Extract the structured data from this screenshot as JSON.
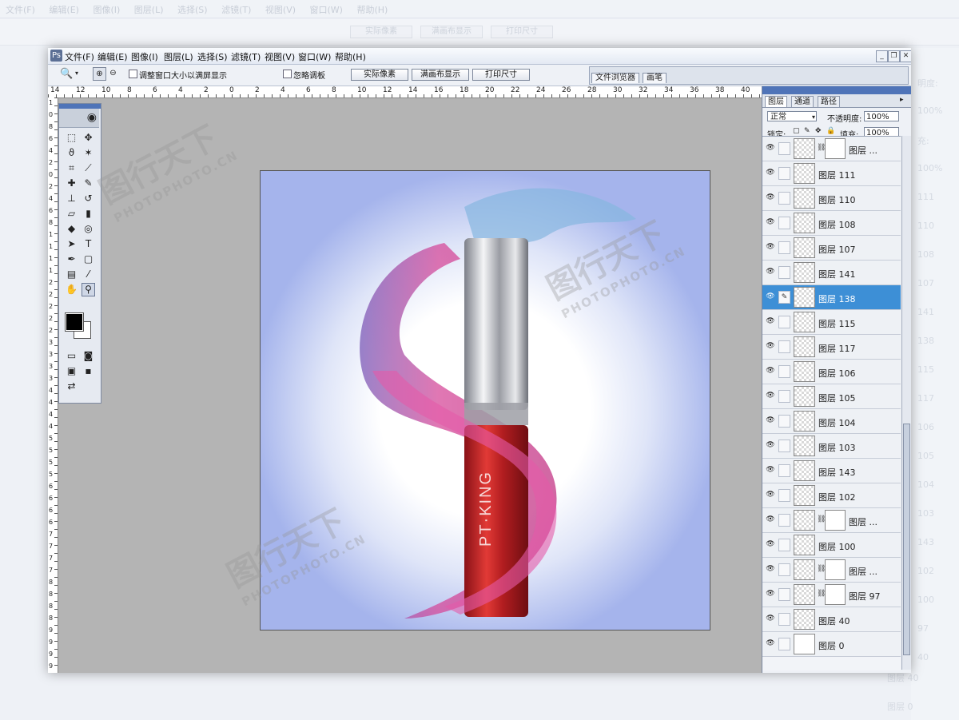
{
  "menu": [
    "文件(F)",
    "编辑(E)",
    "图像(I)",
    "图层(L)",
    "选择(S)",
    "滤镜(T)",
    "视图(V)",
    "窗口(W)",
    "帮助(H)"
  ],
  "options": {
    "fit_window_label": "调整窗口大小以满屏显示",
    "ignore_palettes_label": "忽略调板",
    "actual_pixels": "实际像素",
    "fit_on_screen": "满画布显示",
    "print_size": "打印尺寸"
  },
  "well_tabs": [
    "文件浏览器",
    "画笔"
  ],
  "ruler_h": [
    "14",
    "12",
    "10",
    "8",
    "6",
    "4",
    "2",
    "0",
    "2",
    "4",
    "6",
    "8",
    "10",
    "12",
    "14",
    "16",
    "18",
    "20",
    "22",
    "24",
    "26",
    "28",
    "30",
    "32",
    "34",
    "36",
    "38",
    "40"
  ],
  "ruler_v": [
    "1",
    "0",
    "8",
    "6",
    "4",
    "2",
    "0",
    "2",
    "4",
    "6",
    "8",
    "1",
    "1",
    "1",
    "1",
    "2",
    "2",
    "2",
    "2",
    "2",
    "3",
    "3",
    "3",
    "3",
    "4",
    "4",
    "4",
    "4",
    "5",
    "5",
    "5",
    "5",
    "6",
    "6",
    "6",
    "6",
    "7",
    "7",
    "7",
    "7",
    "8",
    "8",
    "8",
    "8",
    "9",
    "9",
    "9",
    "9"
  ],
  "canvas": {
    "product_text": "PT·KING",
    "watermark_cn": "图行天下",
    "watermark_en": "PHOTOPHOTO.CN"
  },
  "layers_panel": {
    "tabs": [
      "图层",
      "通道",
      "路径"
    ],
    "blend_mode": "正常",
    "opacity_label": "不透明度:",
    "opacity_value": "100%",
    "lock_label": "锁定:",
    "fill_label": "填充:",
    "fill_value": "100%"
  },
  "layers": [
    {
      "name": "图层 ...",
      "mask": true
    },
    {
      "name": "图层 111",
      "mask": false
    },
    {
      "name": "图层 110",
      "mask": false
    },
    {
      "name": "图层 108",
      "mask": false
    },
    {
      "name": "图层 107",
      "mask": false
    },
    {
      "name": "图层 141",
      "mask": false
    },
    {
      "name": "图层 138",
      "mask": false,
      "selected": true
    },
    {
      "name": "图层 115",
      "mask": false
    },
    {
      "name": "图层 117",
      "mask": false
    },
    {
      "name": "图层 106",
      "mask": false
    },
    {
      "name": "图层 105",
      "mask": false
    },
    {
      "name": "图层 104",
      "mask": false
    },
    {
      "name": "图层 103",
      "mask": false
    },
    {
      "name": "图层 143",
      "mask": false
    },
    {
      "name": "图层 102",
      "mask": false
    },
    {
      "name": "图层 ...",
      "mask": true
    },
    {
      "name": "图层 100",
      "mask": false
    },
    {
      "name": "图层 ...",
      "mask": true
    },
    {
      "name": "图层 97",
      "mask": true
    },
    {
      "name": "图层 40",
      "mask": false
    },
    {
      "name": "图层 0",
      "mask": false,
      "white": true
    }
  ],
  "ghost": {
    "right_labels": [
      "明度:",
      "100%",
      "充:",
      "100%",
      "111",
      "110",
      "108",
      "107",
      "141",
      "138",
      "115",
      "117",
      "106",
      "105",
      "104",
      "103",
      "143",
      "102",
      "100",
      "97",
      "40"
    ],
    "bottom_labels": [
      "图层 40",
      "图层 0"
    ]
  },
  "colors": {
    "selection_blue": "#3d8fd6",
    "panel_bar": "#4f74b8",
    "canvas_bg": "#b4b4b4"
  }
}
